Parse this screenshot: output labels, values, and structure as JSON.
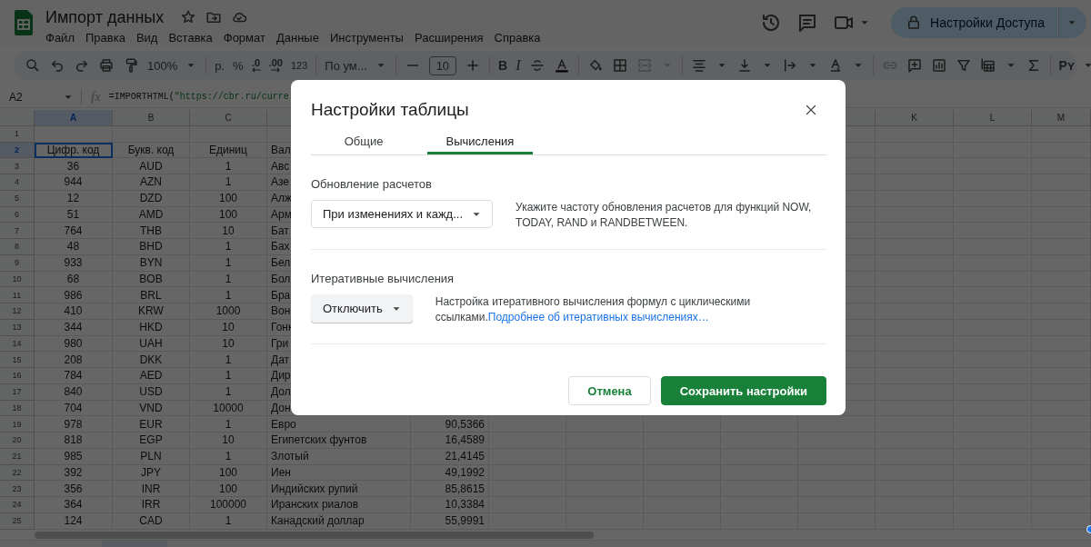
{
  "app": {
    "title": "Импорт данных",
    "menu": [
      "Файл",
      "Правка",
      "Вид",
      "Вставка",
      "Формат",
      "Данные",
      "Инструменты",
      "Расширения",
      "Справка"
    ],
    "share_button": "Настройки Доступа"
  },
  "toolbar": {
    "zoom": "100%",
    "currency": "р.",
    "percent": "%",
    "decrease_decimals": ".0",
    "increase_decimals": ".00",
    "number_format": "123",
    "font": "По ум...",
    "font_size": "10",
    "bold": "B",
    "italic": "I",
    "add_on": "Pʏ"
  },
  "formula_bar": {
    "cell_ref": "A2",
    "function_label": "fx",
    "formula_function": "=IMPORTHTML(",
    "formula_string": "\"https://cbr.ru/curre"
  },
  "sheet": {
    "columns_left": [
      {
        "label": "A",
        "selected": true
      },
      {
        "label": "B",
        "selected": false
      },
      {
        "label": "C",
        "selected": false
      }
    ],
    "columns_right": [
      {
        "label": "K",
        "selected": false
      },
      {
        "label": "L",
        "selected": false
      },
      {
        "label": "M",
        "selected": false
      }
    ],
    "rows": [
      {
        "number": "1",
        "selected": false,
        "cells": []
      },
      {
        "number": "2",
        "selected": true,
        "cells": [
          "Цифр. код",
          "Букв. код",
          "Единиц",
          "Вал"
        ]
      },
      {
        "number": "3",
        "selected": false,
        "cells": [
          "36",
          "AUD",
          "1",
          "Авс"
        ]
      },
      {
        "number": "4",
        "selected": false,
        "cells": [
          "944",
          "AZN",
          "1",
          "Азе"
        ]
      },
      {
        "number": "5",
        "selected": false,
        "cells": [
          "12",
          "DZD",
          "100",
          "Алж"
        ]
      },
      {
        "number": "6",
        "selected": false,
        "cells": [
          "51",
          "AMD",
          "100",
          "Арм"
        ]
      },
      {
        "number": "7",
        "selected": false,
        "cells": [
          "764",
          "THB",
          "10",
          "Бат"
        ]
      },
      {
        "number": "8",
        "selected": false,
        "cells": [
          "48",
          "BHD",
          "1",
          "Бах"
        ]
      },
      {
        "number": "9",
        "selected": false,
        "cells": [
          "933",
          "BYN",
          "1",
          "Бел"
        ]
      },
      {
        "number": "10",
        "selected": false,
        "cells": [
          "68",
          "BOB",
          "1",
          "Бол"
        ]
      },
      {
        "number": "11",
        "selected": false,
        "cells": [
          "986",
          "BRL",
          "1",
          "Бра"
        ]
      },
      {
        "number": "12",
        "selected": false,
        "cells": [
          "410",
          "KRW",
          "1000",
          "Вон"
        ]
      },
      {
        "number": "13",
        "selected": false,
        "cells": [
          "344",
          "HKD",
          "10",
          "Гонк"
        ]
      },
      {
        "number": "14",
        "selected": false,
        "cells": [
          "980",
          "UAH",
          "10",
          "Гри"
        ]
      },
      {
        "number": "15",
        "selected": false,
        "cells": [
          "208",
          "DKK",
          "1",
          "Дат"
        ]
      },
      {
        "number": "16",
        "selected": false,
        "cells": [
          "784",
          "AED",
          "1",
          "Дир"
        ]
      },
      {
        "number": "17",
        "selected": false,
        "cells": [
          "840",
          "USD",
          "1",
          "Дол"
        ]
      },
      {
        "number": "18",
        "selected": false,
        "cells": [
          "704",
          "VND",
          "10000",
          "Дон"
        ]
      },
      {
        "number": "19",
        "selected": false,
        "cells": [
          "978",
          "EUR",
          "1",
          "Евро",
          "90,5366"
        ]
      },
      {
        "number": "20",
        "selected": false,
        "cells": [
          "818",
          "EGP",
          "10",
          "Египетских фунтов",
          "16,4589"
        ]
      },
      {
        "number": "21",
        "selected": false,
        "cells": [
          "985",
          "PLN",
          "1",
          "Злотый",
          "21,4145"
        ]
      },
      {
        "number": "22",
        "selected": false,
        "cells": [
          "392",
          "JPY",
          "100",
          "Иен",
          "49,1992"
        ]
      },
      {
        "number": "23",
        "selected": false,
        "cells": [
          "356",
          "INR",
          "100",
          "Индийских рупий",
          "85,8615"
        ]
      },
      {
        "number": "24",
        "selected": false,
        "cells": [
          "364",
          "IRR",
          "100000",
          "Иранских риалов",
          "10,3384"
        ]
      },
      {
        "number": "25",
        "selected": false,
        "cells": [
          "124",
          "CAD",
          "1",
          "Канадский доллар",
          "55,9991"
        ]
      }
    ]
  },
  "dialog": {
    "title": "Настройки таблицы",
    "tabs": [
      {
        "label": "Общие",
        "selected": false
      },
      {
        "label": "Вычисления",
        "selected": true
      }
    ],
    "sections": [
      {
        "label": "Обновление расчетов",
        "dropdown": "При изменениях и кажд...",
        "kind": "outlined",
        "description": "Укажите частоту обновления расчетов для функций NOW, TODAY, RAND и RANDBETWEEN."
      },
      {
        "label": "Итеративные вычисления",
        "dropdown": "Отключить",
        "kind": "filled",
        "description": "Настройка итеративного вычисления формул с циклическими ссылками.",
        "link": "Подробнее об итеративных вычислениях…"
      }
    ],
    "buttons": [
      {
        "label": "Отмена",
        "kind": "secondary"
      },
      {
        "label": "Сохранить настройки",
        "kind": "primary"
      }
    ]
  }
}
